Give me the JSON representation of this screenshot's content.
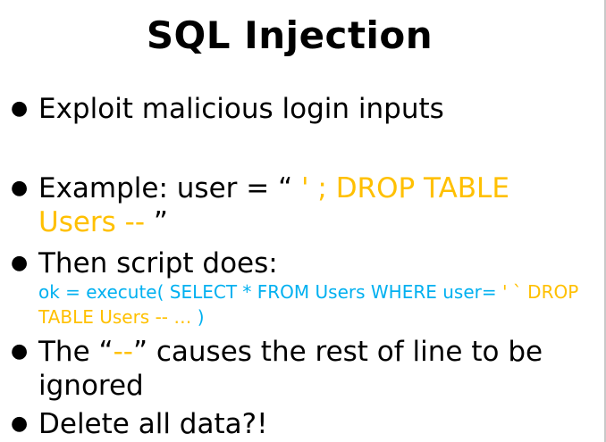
{
  "slide": {
    "title": "SQL Injection",
    "accent_color": "#ffc000",
    "code_color": "#00b0f0",
    "bullets": {
      "b1": {
        "text": "Exploit malicious login inputs"
      },
      "b2": {
        "prefix": "Example: user = “ ",
        "injected": "' ; DROP TABLE Users -- ",
        "suffix": "”"
      },
      "b3": {
        "text": "Then script does:",
        "code_prefix": "ok = execute( SELECT * FROM Users  WHERE user= ",
        "code_injected": "' ` DROP TABLE Users -- …",
        "code_suffix": " )"
      },
      "b4": {
        "prefix": "The “",
        "dashes": "--",
        "suffix": "” causes the rest of line to be ignored"
      },
      "b5": {
        "text": "Delete all data?!"
      }
    }
  }
}
